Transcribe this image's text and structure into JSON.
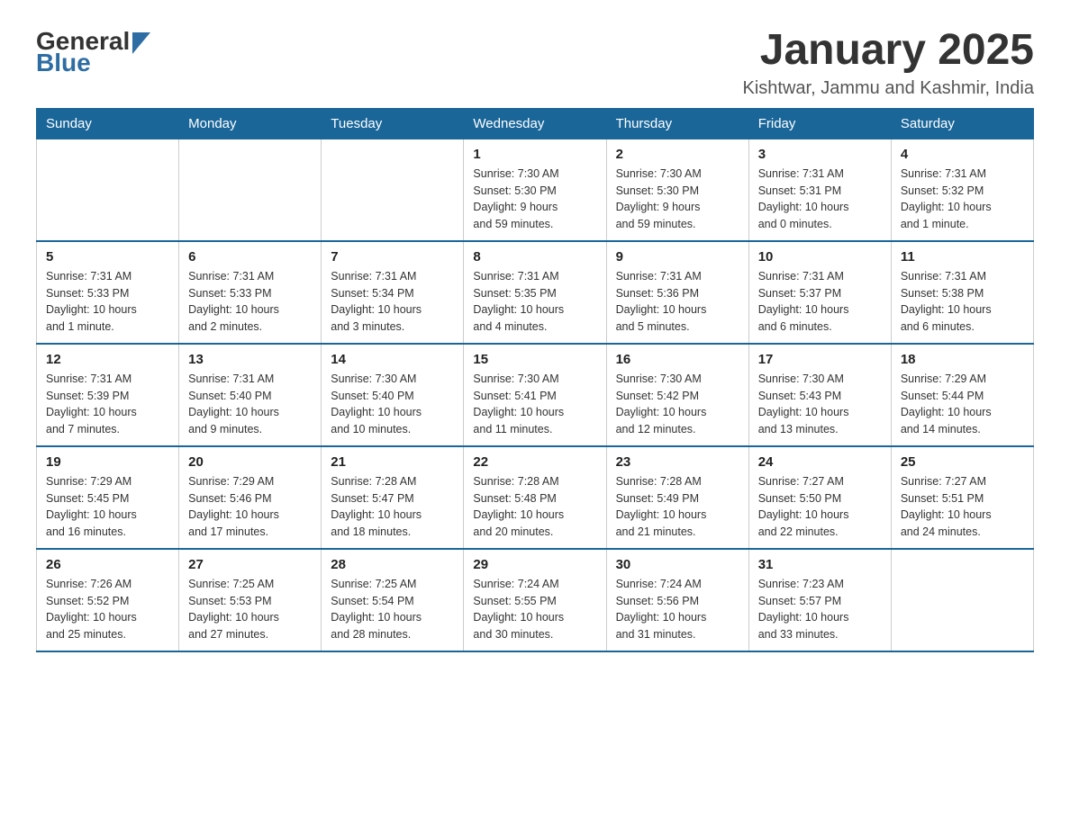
{
  "header": {
    "logo": {
      "general": "General",
      "blue": "Blue"
    },
    "title": "January 2025",
    "location": "Kishtwar, Jammu and Kashmir, India"
  },
  "days_of_week": [
    "Sunday",
    "Monday",
    "Tuesday",
    "Wednesday",
    "Thursday",
    "Friday",
    "Saturday"
  ],
  "weeks": [
    [
      {
        "day": "",
        "info": ""
      },
      {
        "day": "",
        "info": ""
      },
      {
        "day": "",
        "info": ""
      },
      {
        "day": "1",
        "info": "Sunrise: 7:30 AM\nSunset: 5:30 PM\nDaylight: 9 hours\nand 59 minutes."
      },
      {
        "day": "2",
        "info": "Sunrise: 7:30 AM\nSunset: 5:30 PM\nDaylight: 9 hours\nand 59 minutes."
      },
      {
        "day": "3",
        "info": "Sunrise: 7:31 AM\nSunset: 5:31 PM\nDaylight: 10 hours\nand 0 minutes."
      },
      {
        "day": "4",
        "info": "Sunrise: 7:31 AM\nSunset: 5:32 PM\nDaylight: 10 hours\nand 1 minute."
      }
    ],
    [
      {
        "day": "5",
        "info": "Sunrise: 7:31 AM\nSunset: 5:33 PM\nDaylight: 10 hours\nand 1 minute."
      },
      {
        "day": "6",
        "info": "Sunrise: 7:31 AM\nSunset: 5:33 PM\nDaylight: 10 hours\nand 2 minutes."
      },
      {
        "day": "7",
        "info": "Sunrise: 7:31 AM\nSunset: 5:34 PM\nDaylight: 10 hours\nand 3 minutes."
      },
      {
        "day": "8",
        "info": "Sunrise: 7:31 AM\nSunset: 5:35 PM\nDaylight: 10 hours\nand 4 minutes."
      },
      {
        "day": "9",
        "info": "Sunrise: 7:31 AM\nSunset: 5:36 PM\nDaylight: 10 hours\nand 5 minutes."
      },
      {
        "day": "10",
        "info": "Sunrise: 7:31 AM\nSunset: 5:37 PM\nDaylight: 10 hours\nand 6 minutes."
      },
      {
        "day": "11",
        "info": "Sunrise: 7:31 AM\nSunset: 5:38 PM\nDaylight: 10 hours\nand 6 minutes."
      }
    ],
    [
      {
        "day": "12",
        "info": "Sunrise: 7:31 AM\nSunset: 5:39 PM\nDaylight: 10 hours\nand 7 minutes."
      },
      {
        "day": "13",
        "info": "Sunrise: 7:31 AM\nSunset: 5:40 PM\nDaylight: 10 hours\nand 9 minutes."
      },
      {
        "day": "14",
        "info": "Sunrise: 7:30 AM\nSunset: 5:40 PM\nDaylight: 10 hours\nand 10 minutes."
      },
      {
        "day": "15",
        "info": "Sunrise: 7:30 AM\nSunset: 5:41 PM\nDaylight: 10 hours\nand 11 minutes."
      },
      {
        "day": "16",
        "info": "Sunrise: 7:30 AM\nSunset: 5:42 PM\nDaylight: 10 hours\nand 12 minutes."
      },
      {
        "day": "17",
        "info": "Sunrise: 7:30 AM\nSunset: 5:43 PM\nDaylight: 10 hours\nand 13 minutes."
      },
      {
        "day": "18",
        "info": "Sunrise: 7:29 AM\nSunset: 5:44 PM\nDaylight: 10 hours\nand 14 minutes."
      }
    ],
    [
      {
        "day": "19",
        "info": "Sunrise: 7:29 AM\nSunset: 5:45 PM\nDaylight: 10 hours\nand 16 minutes."
      },
      {
        "day": "20",
        "info": "Sunrise: 7:29 AM\nSunset: 5:46 PM\nDaylight: 10 hours\nand 17 minutes."
      },
      {
        "day": "21",
        "info": "Sunrise: 7:28 AM\nSunset: 5:47 PM\nDaylight: 10 hours\nand 18 minutes."
      },
      {
        "day": "22",
        "info": "Sunrise: 7:28 AM\nSunset: 5:48 PM\nDaylight: 10 hours\nand 20 minutes."
      },
      {
        "day": "23",
        "info": "Sunrise: 7:28 AM\nSunset: 5:49 PM\nDaylight: 10 hours\nand 21 minutes."
      },
      {
        "day": "24",
        "info": "Sunrise: 7:27 AM\nSunset: 5:50 PM\nDaylight: 10 hours\nand 22 minutes."
      },
      {
        "day": "25",
        "info": "Sunrise: 7:27 AM\nSunset: 5:51 PM\nDaylight: 10 hours\nand 24 minutes."
      }
    ],
    [
      {
        "day": "26",
        "info": "Sunrise: 7:26 AM\nSunset: 5:52 PM\nDaylight: 10 hours\nand 25 minutes."
      },
      {
        "day": "27",
        "info": "Sunrise: 7:25 AM\nSunset: 5:53 PM\nDaylight: 10 hours\nand 27 minutes."
      },
      {
        "day": "28",
        "info": "Sunrise: 7:25 AM\nSunset: 5:54 PM\nDaylight: 10 hours\nand 28 minutes."
      },
      {
        "day": "29",
        "info": "Sunrise: 7:24 AM\nSunset: 5:55 PM\nDaylight: 10 hours\nand 30 minutes."
      },
      {
        "day": "30",
        "info": "Sunrise: 7:24 AM\nSunset: 5:56 PM\nDaylight: 10 hours\nand 31 minutes."
      },
      {
        "day": "31",
        "info": "Sunrise: 7:23 AM\nSunset: 5:57 PM\nDaylight: 10 hours\nand 33 minutes."
      },
      {
        "day": "",
        "info": ""
      }
    ]
  ]
}
